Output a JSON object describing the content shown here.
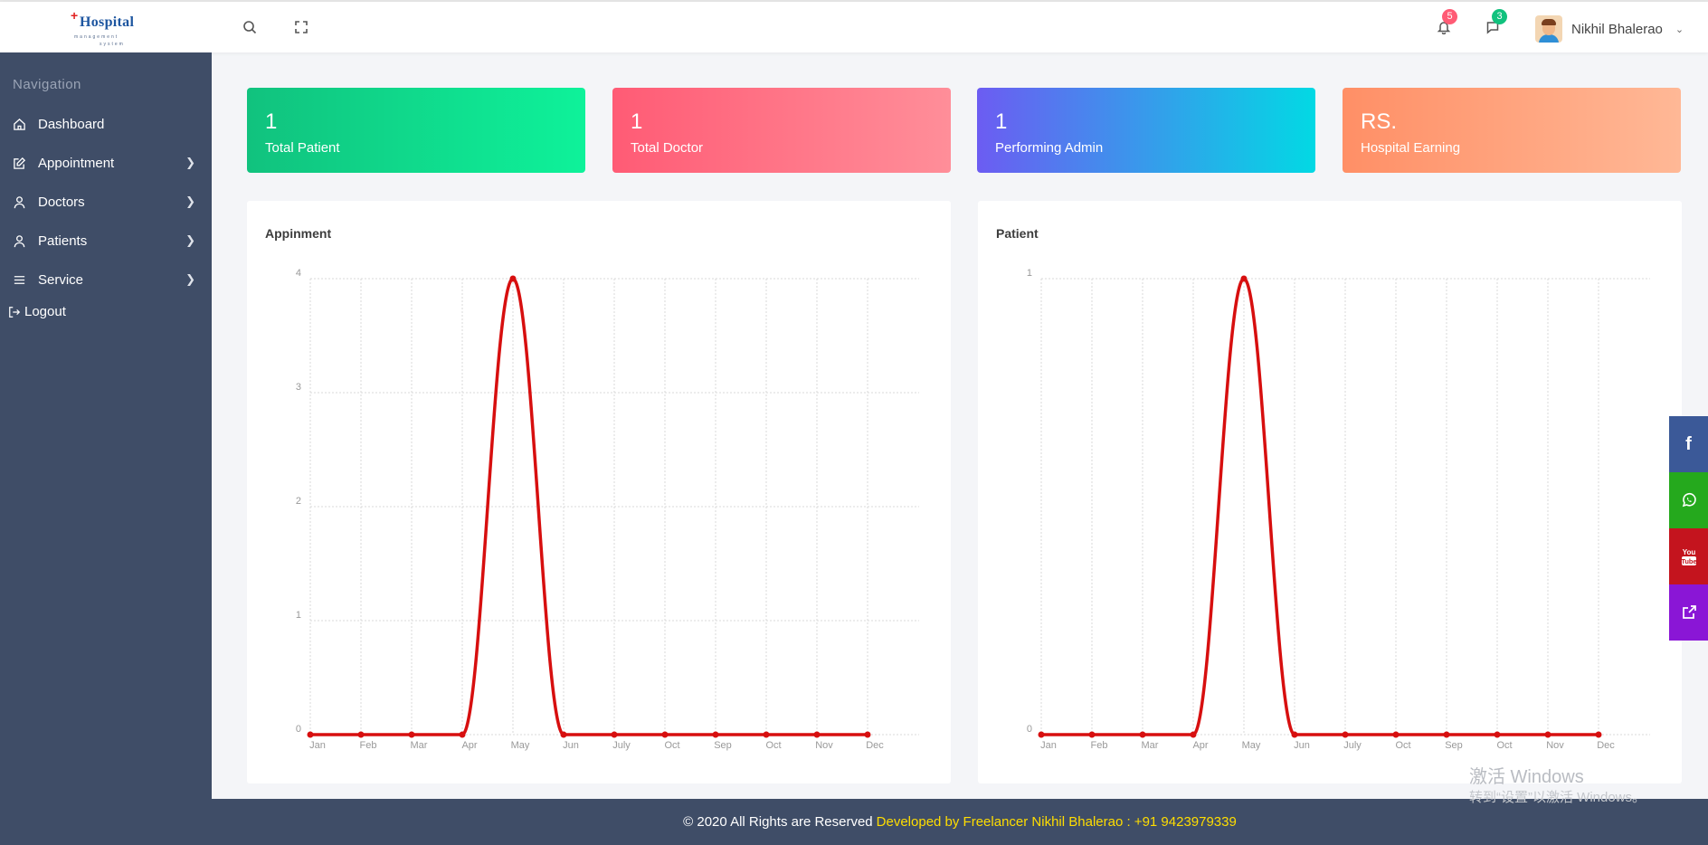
{
  "logo": {
    "word": "Hospital",
    "sub1": "management",
    "sub2": "system"
  },
  "header": {
    "notifications_count": "5",
    "messages_count": "3",
    "user_name": "Nikhil Bhalerao"
  },
  "sidebar": {
    "title": "Navigation",
    "items": [
      {
        "label": "Dashboard",
        "icon": "home-icon",
        "has_submenu": false
      },
      {
        "label": "Appointment",
        "icon": "edit-icon",
        "has_submenu": true
      },
      {
        "label": "Doctors",
        "icon": "user-icon",
        "has_submenu": true
      },
      {
        "label": "Patients",
        "icon": "user-icon",
        "has_submenu": true
      },
      {
        "label": "Service",
        "icon": "menu-icon",
        "has_submenu": true
      }
    ],
    "logout": "Logout"
  },
  "cards": [
    {
      "value": "1",
      "label": "Total Patient",
      "colors": [
        "#11c27e",
        "#0ef29a"
      ]
    },
    {
      "value": "1",
      "label": "Total Doctor",
      "colors": [
        "#ff5b75",
        "#ff8e99"
      ]
    },
    {
      "value": "1",
      "label": "Performing Admin",
      "colors": [
        "#6c5cf2",
        "#02d9e4"
      ]
    },
    {
      "value": "RS.",
      "label": "Hospital Earning",
      "colors": [
        "#ff8f66",
        "#ffb896"
      ]
    }
  ],
  "chart_data": [
    {
      "type": "line",
      "title": "Appinment",
      "categories": [
        "Jan",
        "Feb",
        "Mar",
        "Apr",
        "May",
        "Jun",
        "July",
        "Oct",
        "Sep",
        "Oct",
        "Nov",
        "Dec"
      ],
      "values": [
        0,
        0,
        0,
        0,
        4,
        0,
        0,
        0,
        0,
        0,
        0,
        0
      ],
      "ylim": [
        0,
        4
      ],
      "yticks": [
        0,
        1,
        2,
        3,
        4
      ],
      "grid": true,
      "color": "#d70f0f"
    },
    {
      "type": "line",
      "title": "Patient",
      "categories": [
        "Jan",
        "Feb",
        "Mar",
        "Apr",
        "May",
        "Jun",
        "July",
        "Oct",
        "Sep",
        "Oct",
        "Nov",
        "Dec"
      ],
      "values": [
        0,
        0,
        0,
        0,
        1,
        0,
        0,
        0,
        0,
        0,
        0,
        0
      ],
      "ylim": [
        0,
        1
      ],
      "yticks": [
        0,
        1
      ],
      "grid": true,
      "color": "#d70f0f"
    }
  ],
  "footer": {
    "copyright": "© 2020 All Rights are Reserved",
    "credit": "Developed by Freelancer Nikhil Bhalerao : +91 9423979339"
  },
  "social": [
    {
      "icon": "facebook-icon",
      "color": "#3b5998"
    },
    {
      "icon": "whatsapp-icon",
      "color": "#25a91d"
    },
    {
      "icon": "youtube-icon",
      "color": "#c4141e"
    },
    {
      "icon": "external-link-icon",
      "color": "#8a16d6"
    }
  ],
  "watermark": {
    "line1": "激活 Windows",
    "line2": "转到“设置”以激活 Windows。"
  }
}
